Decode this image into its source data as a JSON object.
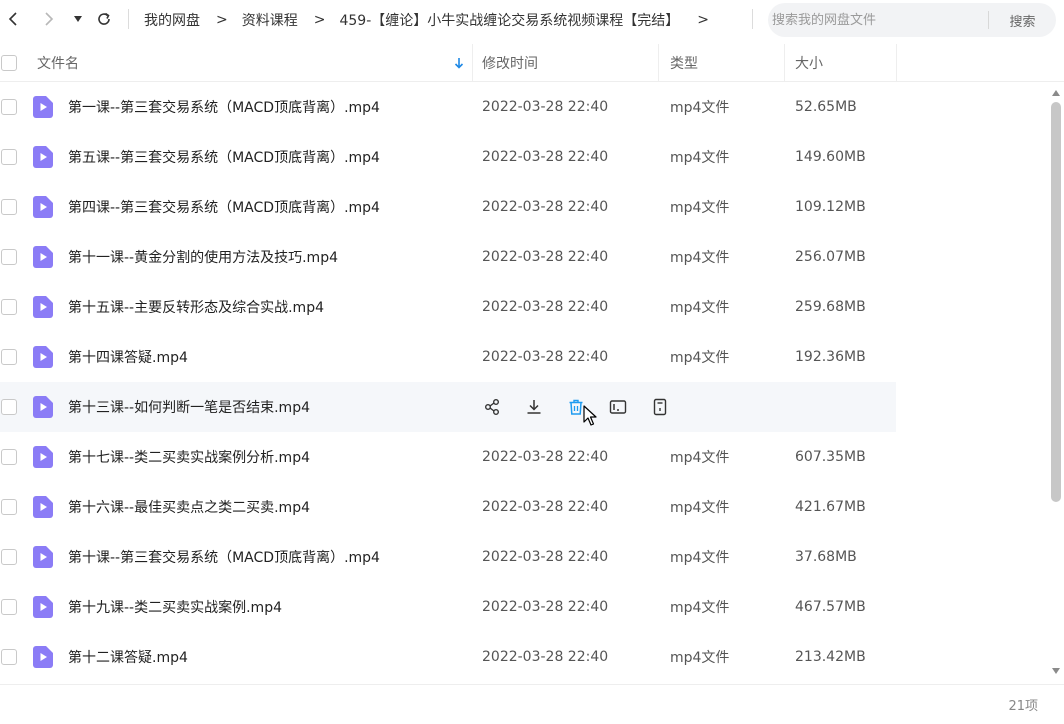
{
  "nav": {
    "breadcrumb": [
      "我的网盘",
      "资料课程",
      "459-【缠论】小牛实战缠论交易系统视频课程【完结】"
    ],
    "separator": ">",
    "search_placeholder": "搜索我的网盘文件",
    "search_button": "搜索"
  },
  "columns": {
    "name": "文件名",
    "modified": "修改时间",
    "type": "类型",
    "size": "大小"
  },
  "files": [
    {
      "name": "第一课--第三套交易系统（MACD顶底背离）.mp4",
      "modified": "2022-03-28 22:40",
      "type": "mp4文件",
      "size": "52.65MB"
    },
    {
      "name": "第五课--第三套交易系统（MACD顶底背离）.mp4",
      "modified": "2022-03-28 22:40",
      "type": "mp4文件",
      "size": "149.60MB"
    },
    {
      "name": "第四课--第三套交易系统（MACD顶底背离）.mp4",
      "modified": "2022-03-28 22:40",
      "type": "mp4文件",
      "size": "109.12MB"
    },
    {
      "name": "第十一课--黄金分割的使用方法及技巧.mp4",
      "modified": "2022-03-28 22:40",
      "type": "mp4文件",
      "size": "256.07MB"
    },
    {
      "name": "第十五课--主要反转形态及综合实战.mp4",
      "modified": "2022-03-28 22:40",
      "type": "mp4文件",
      "size": "259.68MB"
    },
    {
      "name": "第十四课答疑.mp4",
      "modified": "2022-03-28 22:40",
      "type": "mp4文件",
      "size": "192.36MB"
    },
    {
      "name": "第十三课--如何判断一笔是否结束.mp4",
      "modified": "",
      "type": "",
      "size": "",
      "hovered": true
    },
    {
      "name": "第十七课--类二买卖实战案例分析.mp4",
      "modified": "2022-03-28 22:40",
      "type": "mp4文件",
      "size": "607.35MB"
    },
    {
      "name": "第十六课--最佳买卖点之类二买卖.mp4",
      "modified": "2022-03-28 22:40",
      "type": "mp4文件",
      "size": "421.67MB"
    },
    {
      "name": "第十课--第三套交易系统（MACD顶底背离）.mp4",
      "modified": "2022-03-28 22:40",
      "type": "mp4文件",
      "size": "37.68MB"
    },
    {
      "name": "第十九课--类二买卖实战案例.mp4",
      "modified": "2022-03-28 22:40",
      "type": "mp4文件",
      "size": "467.57MB"
    },
    {
      "name": "第十二课答疑.mp4",
      "modified": "2022-03-28 22:40",
      "type": "mp4文件",
      "size": "213.42MB"
    }
  ],
  "footer": {
    "item_count": "21项"
  },
  "colors": {
    "accent": "#1e9bf0",
    "file_icon": "#8b7cf6"
  }
}
